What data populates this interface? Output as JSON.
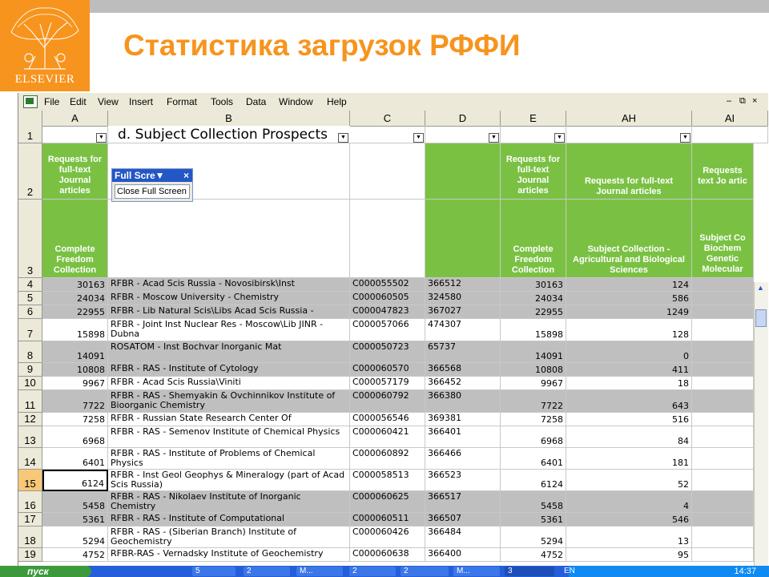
{
  "slide": {
    "title": "Статистика загрузок РФФИ",
    "logo_text": "ELSEVIER"
  },
  "menu": {
    "items": [
      "File",
      "Edit",
      "View",
      "Insert",
      "Format",
      "Tools",
      "Data",
      "Window",
      "Help"
    ],
    "window_controls": [
      "–",
      "⧉",
      "×"
    ]
  },
  "columns": [
    "A",
    "B",
    "C",
    "D",
    "E",
    "AH",
    "AI"
  ],
  "sheet_title": "d. Subject Collection Prospects",
  "fullscreen": {
    "title": "Full Scre▼",
    "close_x": "×",
    "button_label": "Close Full Screen"
  },
  "headers": {
    "row2_A": "Requests for full-text Journal articles",
    "row3_A": "Complete Freedom Collection",
    "row2_E": "Requests for full-text Journal articles",
    "row3_E": "Complete Freedom Collection",
    "row2_AH": "Requests for full-text Journal articles",
    "row3_AH": "Subject Collection - Agricultural and Biological Sciences",
    "row2_AI": "Requests text Jo artic",
    "row3_AI": "Subject Co Biochem Genetic Molecular"
  },
  "row_numbers": [
    "1",
    "2",
    "3"
  ],
  "rows": [
    {
      "n": "4",
      "a": "30163",
      "b": "RFBR - Acad Scis Russia - Novosibirsk\\Inst",
      "c": "C000055502",
      "d": "366512",
      "e": "30163",
      "ah": "124"
    },
    {
      "n": "5",
      "a": "24034",
      "b": "RFBR - Moscow University - Chemistry",
      "c": "C000060505",
      "d": "324580",
      "e": "24034",
      "ah": "586"
    },
    {
      "n": "6",
      "a": "22955",
      "b": "RFBR - Lib Natural Scis\\Libs Acad Scis Russia -",
      "c": "C000047823",
      "d": "367027",
      "e": "22955",
      "ah": "1249"
    },
    {
      "n": "7",
      "a": "15898",
      "b": "RFBR - Joint Inst Nuclear Res - Moscow\\Lib JINR - Dubna",
      "c": "C000057066",
      "d": "474307",
      "e": "15898",
      "ah": "128"
    },
    {
      "n": "8",
      "a": "14091",
      "b": "ROSATOM - Inst Bochvar Inorganic Mat",
      "c": "C000050723",
      "d": "65737",
      "e": "14091",
      "ah": "0"
    },
    {
      "n": "9",
      "a": "10808",
      "b": "RFBR - RAS - Institute of Cytology",
      "c": "C000060570",
      "d": "366568",
      "e": "10808",
      "ah": "411"
    },
    {
      "n": "10",
      "a": "9967",
      "b": "RFBR - Acad Scis Russia\\Viniti",
      "c": "C000057179",
      "d": "366452",
      "e": "9967",
      "ah": "18"
    },
    {
      "n": "11",
      "a": "7722",
      "b": "RFBR - RAS - Shemyakin & Ovchinnikov Institute of Bioorganic Chemistry",
      "c": "C000060792",
      "d": "366380",
      "e": "7722",
      "ah": "643"
    },
    {
      "n": "12",
      "a": "7258",
      "b": "RFBR - Russian State Research Center Of",
      "c": "C000056546",
      "d": "369381",
      "e": "7258",
      "ah": "516"
    },
    {
      "n": "13",
      "a": "6968",
      "b": "RFBR - RAS - Semenov Institute of Chemical Physics",
      "c": "C000060421",
      "d": "366401",
      "e": "6968",
      "ah": "84"
    },
    {
      "n": "14",
      "a": "6401",
      "b": "RFBR - RAS - Institute of Problems of Chemical Physics",
      "c": "C000060892",
      "d": "366466",
      "e": "6401",
      "ah": "181"
    },
    {
      "n": "15",
      "a": "6124",
      "b": "RFBR - Inst Geol Geophys & Mineralogy (part of Acad Scis Russia)",
      "c": "C000058513",
      "d": "366523",
      "e": "6124",
      "ah": "52"
    },
    {
      "n": "16",
      "a": "5458",
      "b": "RFBR - RAS - Nikolaev Institute of Inorganic Chemistry",
      "c": "C000060625",
      "d": "366517",
      "e": "5458",
      "ah": "4"
    },
    {
      "n": "17",
      "a": "5361",
      "b": "RFBR - RAS - Institute of Computational",
      "c": "C000060511",
      "d": "366507",
      "e": "5361",
      "ah": "546"
    },
    {
      "n": "18",
      "a": "5294",
      "b": "RFBR - RAS - (Siberian Branch) Institute of Geochemistry",
      "c": "C000060426",
      "d": "366484",
      "e": "5294",
      "ah": "13"
    },
    {
      "n": "19",
      "a": "4752",
      "b": "RFBR-RAS - Vernadsky Institute of Geochemistry",
      "c": "C000060638",
      "d": "366400",
      "e": "4752",
      "ah": "95"
    }
  ],
  "taskbar": {
    "start_label": "пуск",
    "items": [
      "5",
      "2",
      "M...",
      "2",
      "2",
      "M...",
      "3"
    ],
    "lang": "EN",
    "clock": "14:37"
  },
  "colors": {
    "accent": "#f7941d",
    "green_header": "#7ac143",
    "gray_row": "#bfbfbf",
    "excel_chrome": "#ece9d8",
    "taskbar": "#245edb"
  }
}
